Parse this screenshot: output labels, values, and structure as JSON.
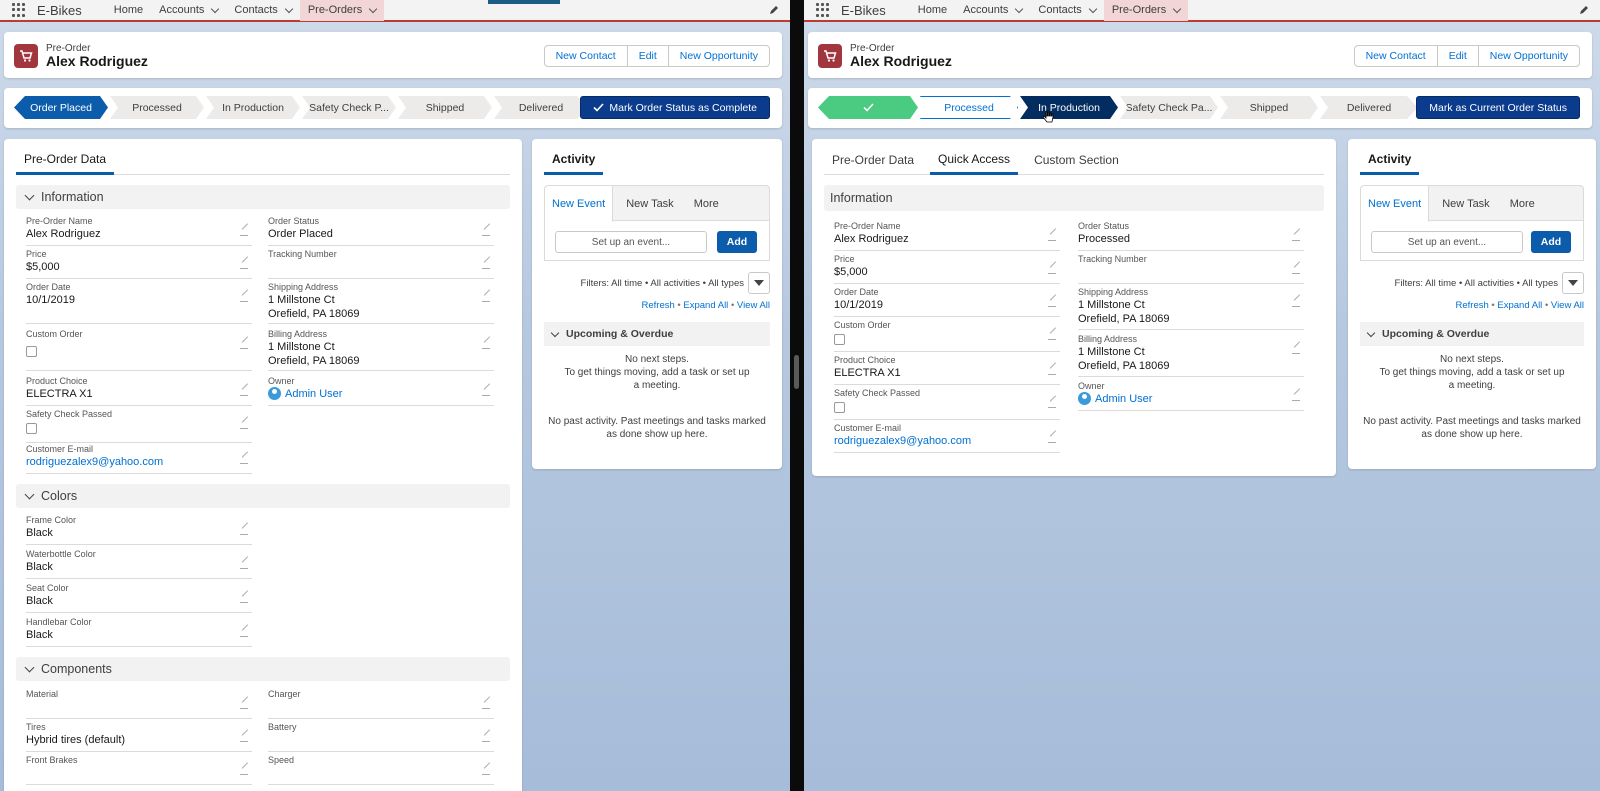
{
  "nav": {
    "app_name": "E-Bikes",
    "items": [
      {
        "label": "Home",
        "dropdown": false
      },
      {
        "label": "Accounts",
        "dropdown": true
      },
      {
        "label": "Contacts",
        "dropdown": true
      },
      {
        "label": "Pre-Orders",
        "dropdown": true,
        "active": true
      }
    ]
  },
  "record": {
    "type": "Pre-Order",
    "name": "Alex Rodriguez",
    "actions": [
      "New Contact",
      "Edit",
      "New Opportunity"
    ]
  },
  "left": {
    "path": {
      "stages": [
        "Order Placed",
        "Processed",
        "In Production",
        "Safety Check P...",
        "Shipped",
        "Delivered"
      ],
      "current": "Order Placed",
      "button": "Mark Order Status as Complete"
    },
    "tabs": [
      "Pre-Order Data"
    ],
    "sections": {
      "information": "Information",
      "colors": "Colors",
      "components": "Components"
    },
    "info_fields": {
      "pre_order_name": {
        "label": "Pre-Order Name",
        "value": "Alex Rodriguez"
      },
      "price": {
        "label": "Price",
        "value": "$5,000"
      },
      "order_date": {
        "label": "Order Date",
        "value": "10/1/2019"
      },
      "custom_order": {
        "label": "Custom Order",
        "checked": false
      },
      "product_choice": {
        "label": "Product Choice",
        "value": "ELECTRA X1"
      },
      "safety_check": {
        "label": "Safety Check Passed",
        "checked": false
      },
      "customer_email": {
        "label": "Customer E-mail",
        "value": "rodriguezalex9@yahoo.com"
      },
      "order_status": {
        "label": "Order Status",
        "value": "Order Placed"
      },
      "tracking_number": {
        "label": "Tracking Number",
        "value": ""
      },
      "shipping_address": {
        "label": "Shipping Address",
        "line1": "1 Millstone Ct",
        "line2": "Orefield, PA 18069"
      },
      "billing_address": {
        "label": "Billing Address",
        "line1": "1 Millstone Ct",
        "line2": "Orefield, PA 18069"
      },
      "owner": {
        "label": "Owner",
        "value": "Admin User"
      }
    },
    "color_fields": {
      "frame": {
        "label": "Frame Color",
        "value": "Black"
      },
      "waterbottle": {
        "label": "Waterbottle Color",
        "value": "Black"
      },
      "seat": {
        "label": "Seat Color",
        "value": "Black"
      },
      "handlebar": {
        "label": "Handlebar Color",
        "value": "Black"
      }
    },
    "component_fields": {
      "material": {
        "label": "Material",
        "value": ""
      },
      "charger": {
        "label": "Charger",
        "value": ""
      },
      "tires": {
        "label": "Tires",
        "value": "Hybrid tires (default)"
      },
      "battery": {
        "label": "Battery",
        "value": ""
      },
      "front_brakes": {
        "label": "Front Brakes",
        "value": ""
      },
      "speed": {
        "label": "Speed",
        "value": ""
      }
    }
  },
  "right": {
    "path": {
      "stages": [
        "",
        "Processed",
        "In Production",
        "Safety Check Pa...",
        "Shipped",
        "Delivered"
      ],
      "current": "In Production",
      "button": "Mark as Current Order Status"
    },
    "tabs": [
      "Pre-Order Data",
      "Quick Access",
      "Custom Section"
    ],
    "active_tab": "Quick Access",
    "section": "Information",
    "info_fields": {
      "pre_order_name": {
        "label": "Pre-Order Name",
        "value": "Alex Rodriguez"
      },
      "price": {
        "label": "Price",
        "value": "$5,000"
      },
      "order_date": {
        "label": "Order Date",
        "value": "10/1/2019"
      },
      "custom_order": {
        "label": "Custom Order",
        "checked": false
      },
      "product_choice": {
        "label": "Product Choice",
        "value": "ELECTRA X1"
      },
      "safety_check": {
        "label": "Safety Check Passed",
        "checked": false
      },
      "customer_email": {
        "label": "Customer E-mail",
        "value": "rodriguezalex9@yahoo.com"
      },
      "order_status": {
        "label": "Order Status",
        "value": "Processed"
      },
      "tracking_number": {
        "label": "Tracking Number",
        "value": ""
      },
      "shipping_address": {
        "label": "Shipping Address",
        "line1": "1 Millstone Ct",
        "line2": "Orefield, PA 18069"
      },
      "billing_address": {
        "label": "Billing Address",
        "line1": "1 Millstone Ct",
        "line2": "Orefield, PA 18069"
      },
      "owner": {
        "label": "Owner",
        "value": "Admin User"
      }
    }
  },
  "activity": {
    "title": "Activity",
    "tabs": [
      "New Event",
      "New Task",
      "More"
    ],
    "event_placeholder": "Set up an event...",
    "add_label": "Add",
    "filters": "Filters: All time • All activities • All types",
    "links": [
      "Refresh",
      "Expand All",
      "View All"
    ],
    "upcoming_title": "Upcoming & Overdue",
    "no_steps": "No next steps.",
    "no_steps_hint": "To get things moving, add a task or set up a meeting.",
    "no_past": "No past activity. Past meetings and tasks marked as done show up here."
  },
  "colors": {
    "path_current": "#0b5cab",
    "path_done": "#4bca81",
    "path_navy": "#032d60",
    "nav_accent": "#c23934",
    "link": "#0070d2"
  }
}
